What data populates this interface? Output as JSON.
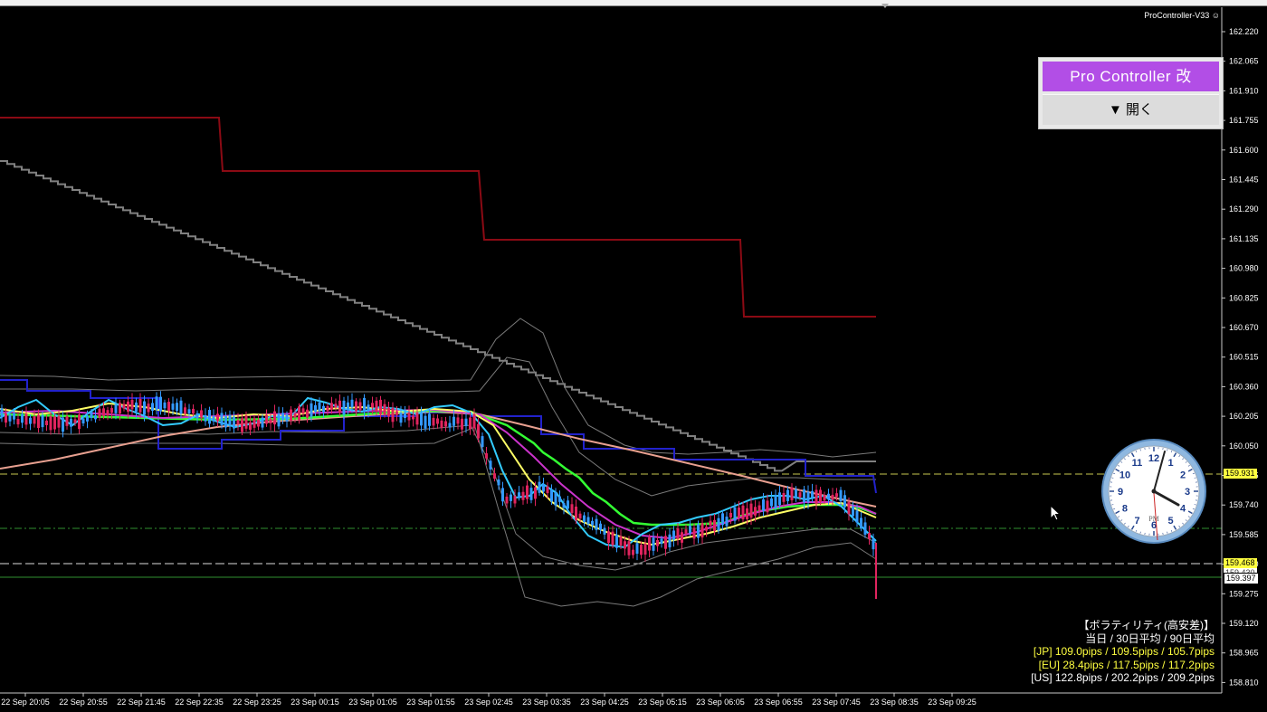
{
  "indicator_name": "ProController-V33",
  "pro_controller": {
    "title": "Pro Controller 改",
    "open_button": "▼ 開く"
  },
  "price_axis": [
    "162.220",
    "162.065",
    "161.910",
    "161.755",
    "161.600",
    "161.445",
    "161.290",
    "161.135",
    "160.980",
    "160.825",
    "160.670",
    "160.515",
    "160.360",
    "160.205",
    "160.050",
    "159.895",
    "159.740",
    "159.585",
    "159.430",
    "159.275",
    "159.120",
    "158.965",
    "158.810"
  ],
  "price_tags": {
    "upper": "159.931",
    "current": "159.468",
    "bid": "159.397",
    "partial": "159.430"
  },
  "time_axis": [
    "22 Sep 20:05",
    "22 Sep 20:55",
    "22 Sep 21:45",
    "22 Sep 22:35",
    "22 Sep 23:25",
    "23 Sep 00:15",
    "23 Sep 01:05",
    "23 Sep 01:55",
    "23 Sep 02:45",
    "23 Sep 03:35",
    "23 Sep 04:25",
    "23 Sep 05:15",
    "23 Sep 06:05",
    "23 Sep 06:55",
    "23 Sep 07:45",
    "23 Sep 08:35",
    "23 Sep 09:25"
  ],
  "volatility": {
    "title": "【ボラティリティ(高安差)】",
    "header": "当日 / 30日平均 / 90日平均",
    "jp": "[JP] 109.0pips / 109.5pips / 105.7pips",
    "eu": "[EU] 28.4pips / 117.5pips / 117.2pips",
    "us": "[US] 122.8pips / 202.2pips / 209.2pips"
  },
  "clock": {
    "label": "PM",
    "numbers": [
      "12",
      "1",
      "2",
      "3",
      "4",
      "5",
      "6",
      "7",
      "8",
      "9",
      "10",
      "11"
    ]
  },
  "colors": {
    "background": "#000000",
    "candle_up": "#3399ff",
    "candle_down": "#e0245e",
    "ma_fast": "#33ccff",
    "ma_yellow": "#ffff66",
    "ma_magenta": "#cc33cc",
    "ma_green": "#33ff33",
    "ma_salmon": "#e8a090",
    "donchian": "#2222cc",
    "step_red": "#8b0a14",
    "grey_line": "#808080",
    "panel_purple": "#b24ee6"
  }
}
